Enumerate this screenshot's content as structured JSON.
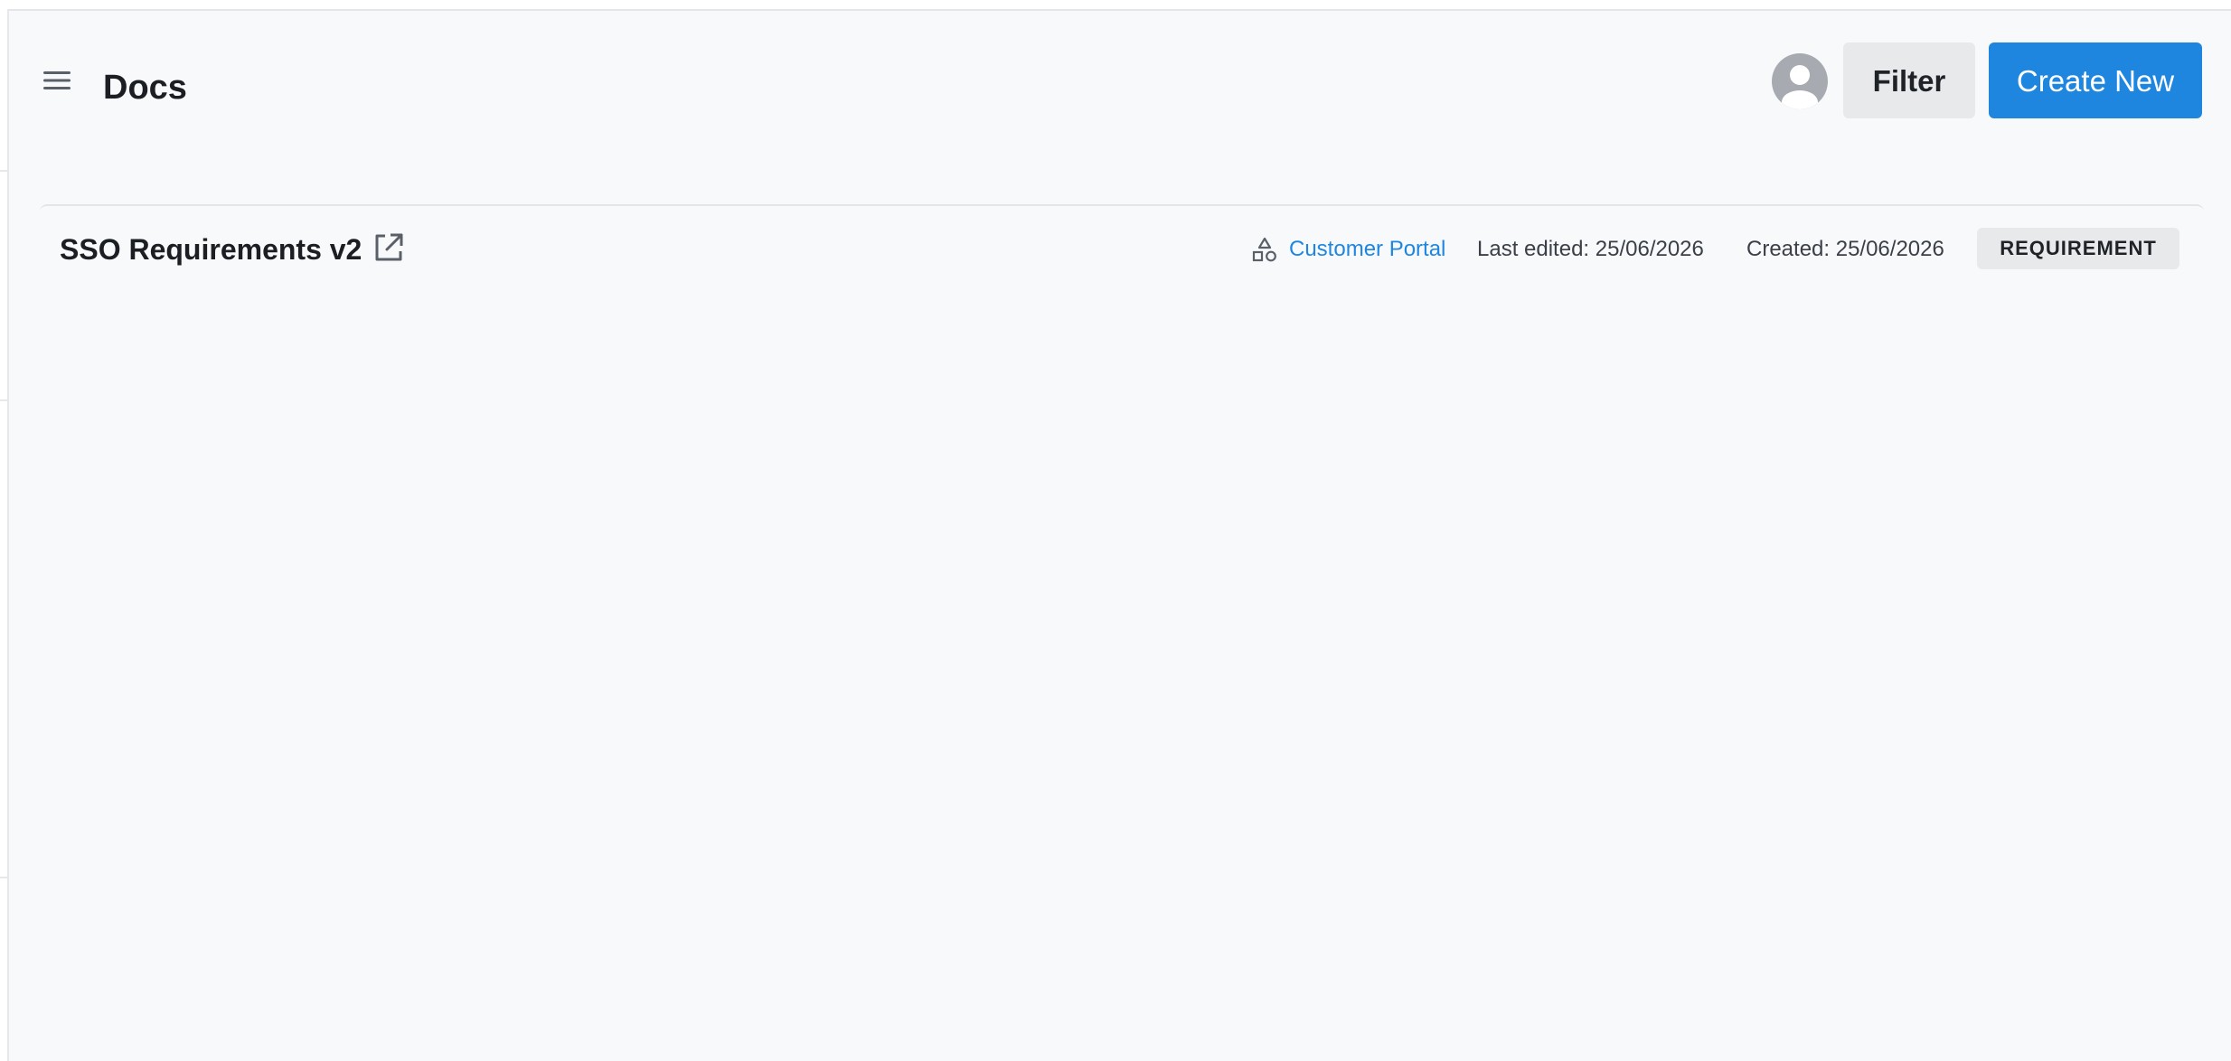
{
  "header": {
    "title": "Docs",
    "filter_label": "Filter",
    "create_label": "Create New"
  },
  "icons": {
    "menu": "hamburger-menu-icon",
    "avatar": "user-avatar-icon",
    "open": "external-link-icon",
    "project": "shapes-icon"
  },
  "docs": [
    {
      "title": "SSO Requirements v2",
      "project": "Customer Portal",
      "last_edited": "Last edited: 25/06/2026",
      "created": "Created: 25/06/2026",
      "type": "REQUIREMENT"
    }
  ],
  "colors": {
    "accent": "#1f86e0",
    "background": "#f8f9fb",
    "badge_bg": "#e8e9eb",
    "avatar": "#a7abb1"
  }
}
